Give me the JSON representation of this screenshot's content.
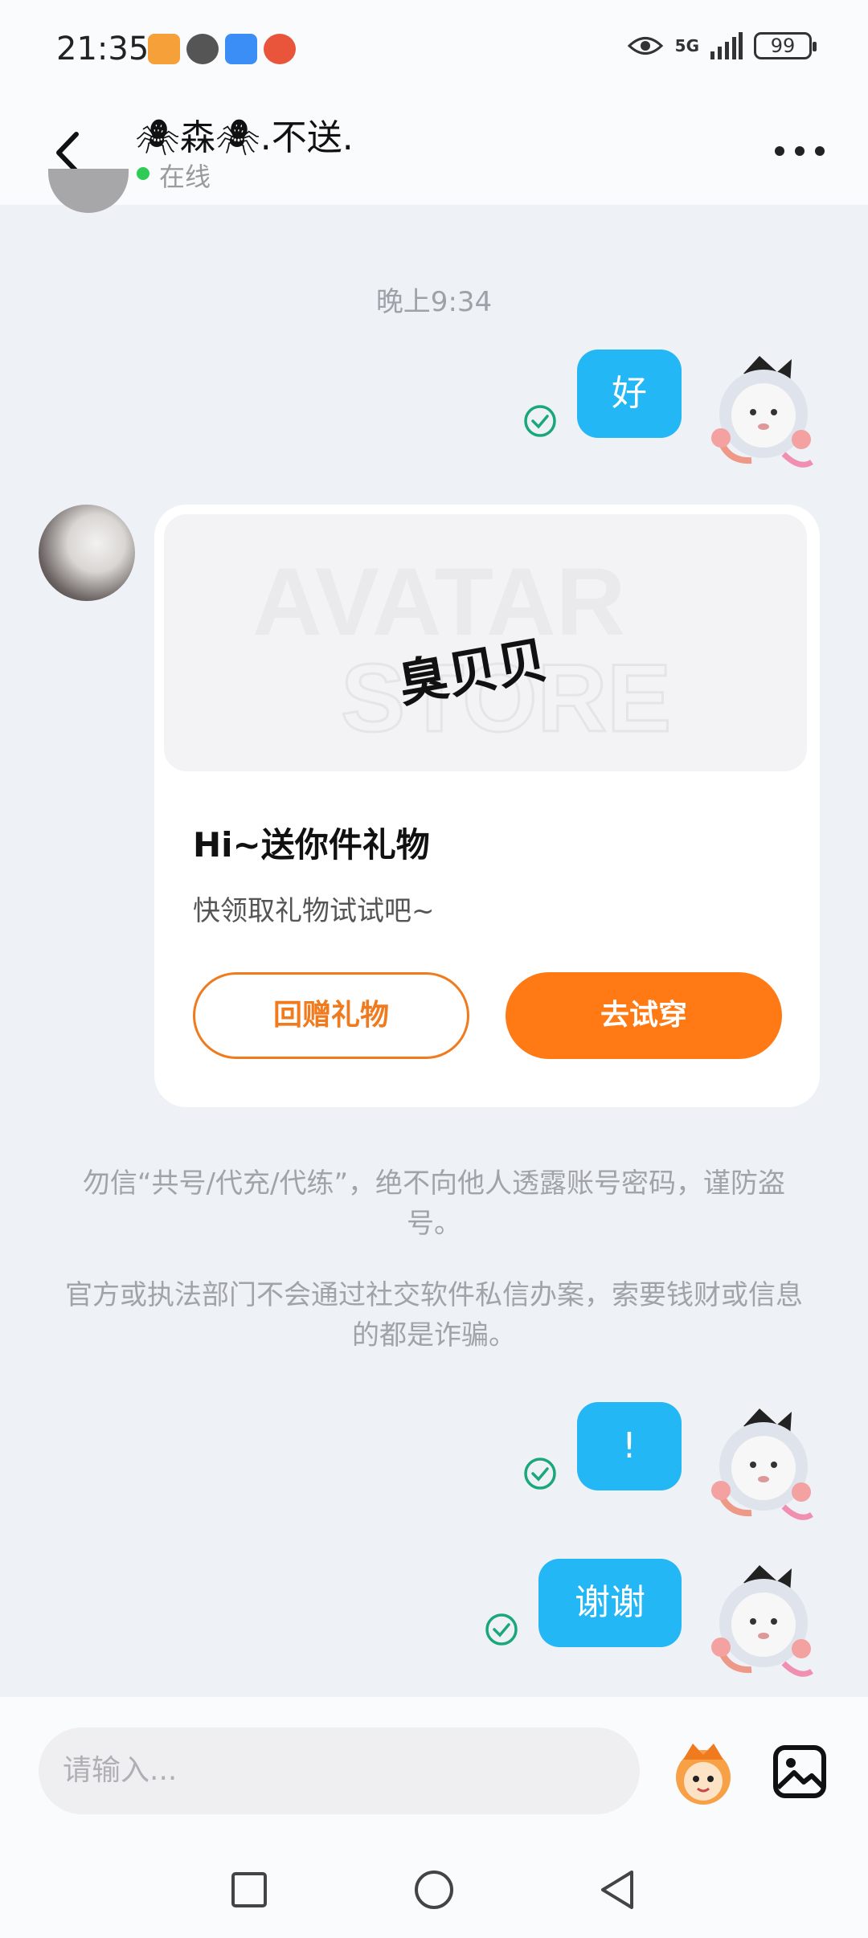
{
  "status_bar": {
    "time": "21:35",
    "network": "5G",
    "battery": "99"
  },
  "header": {
    "title": "🕷森🕷.不送.",
    "status": "在线",
    "back_icon": "chevron-left-icon",
    "more_icon": "more-horizontal-icon"
  },
  "messages": {
    "timestamp": "晚上9:34",
    "msg1": "好",
    "msg2": "!",
    "msg3": "谢谢"
  },
  "gift_card": {
    "banner_watermark_1": "AVATAR",
    "banner_watermark_2": "STORE",
    "banner_text": "臭贝贝",
    "title": "Hi~送你件礼物",
    "subtitle": "快领取礼物试试吧~",
    "return_button": "回赠礼物",
    "try_button": "去试穿"
  },
  "notices": {
    "notice1": "勿信“共号/代充/代练”，绝不向他人透露账号密码，谨防盗号。",
    "notice2": "官方或执法部门不会通过社交软件私信办案，索要钱财或信息的都是诈骗。"
  },
  "input": {
    "placeholder": "请输入..."
  },
  "colors": {
    "bubble_blue": "#23b7f5",
    "accent_orange": "#ff7a14",
    "check_green": "#1aa77a",
    "online_green": "#2ecc55"
  }
}
